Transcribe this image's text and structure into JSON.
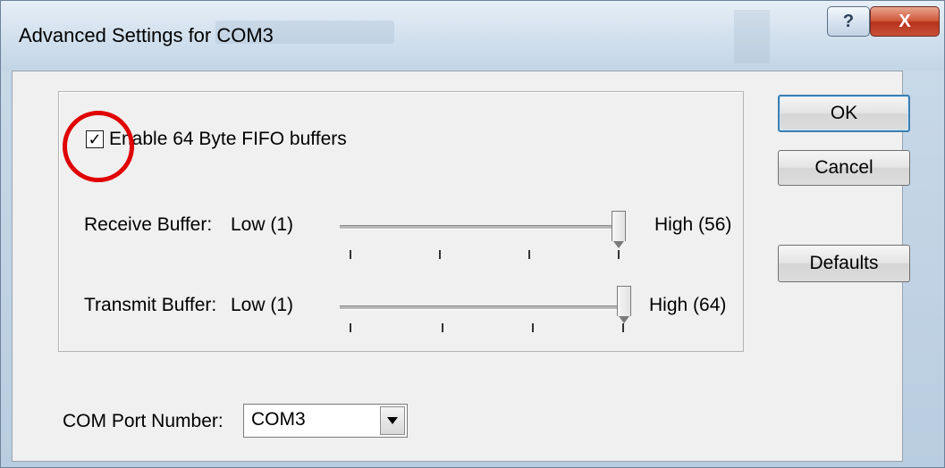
{
  "window": {
    "title": "Advanced Settings for COM3",
    "help_glyph": "?",
    "close_glyph": "X"
  },
  "fifo": {
    "checkbox_label": "Enable 64 Byte FIFO buffers",
    "checked": true,
    "check_glyph": "✓"
  },
  "receive": {
    "label": "Receive Buffer:",
    "low": "Low (1)",
    "high": "High (56)",
    "level": 1.0
  },
  "transmit": {
    "label": "Transmit Buffer:",
    "low": "Low (1)",
    "high": "High (64)",
    "level": 1.0
  },
  "buttons": {
    "ok": "OK",
    "cancel": "Cancel",
    "defaults": "Defaults"
  },
  "com_port": {
    "label": "COM Port Number:",
    "selected": "COM3"
  },
  "colors": {
    "annotation": "#e00000",
    "close_button": "#c9503a",
    "default_button_border": "#3c7fb1"
  },
  "icons": {
    "help": "question-mark-icon",
    "close": "close-icon",
    "dropdown": "chevron-down-icon"
  }
}
